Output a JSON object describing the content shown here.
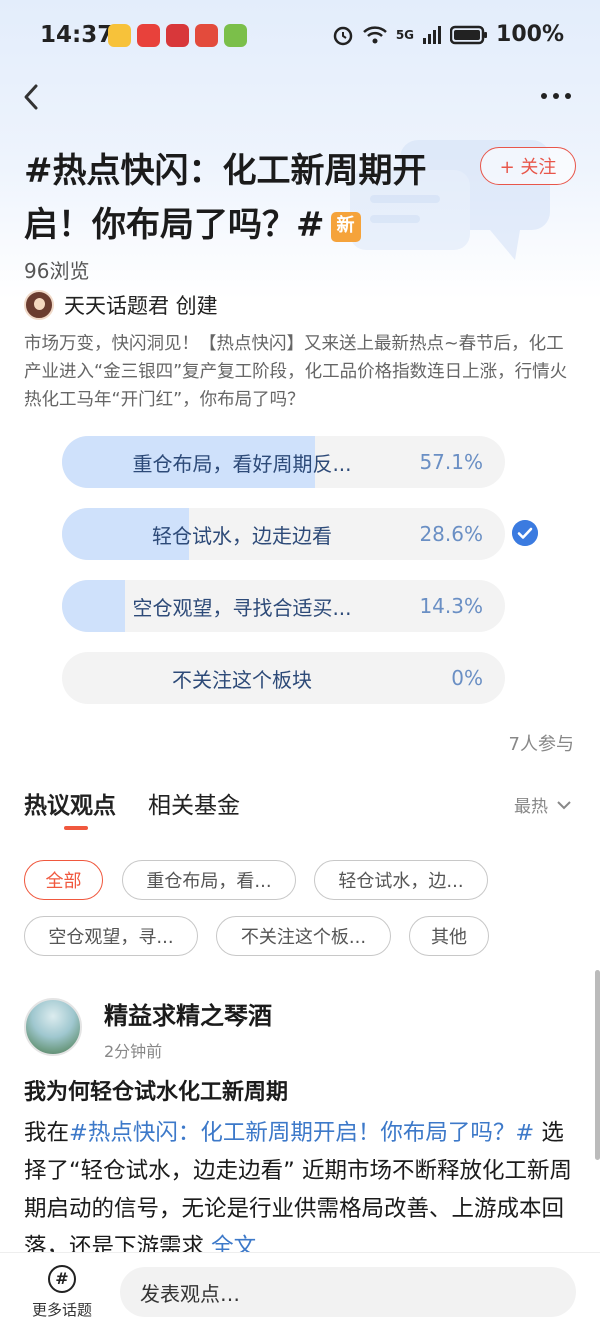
{
  "status_bar": {
    "time": "14:37",
    "network": "5G",
    "battery": "100%",
    "app_icon_colors": [
      "#f7c23a",
      "#e8413b",
      "#d8373a",
      "#e34b3c",
      "#7bbf4a"
    ]
  },
  "nav": {
    "back_icon": "chevron-left-icon",
    "more_icon": "more-horizontal-icon"
  },
  "topic": {
    "title": "#热点快闪：化工新周期开启！你布局了吗？#",
    "new_badge": "新",
    "follow_label": "+ 关注",
    "views": "96浏览",
    "creator": "天天话题君 创建",
    "description": "市场万变，快闪洞见！【热点快闪】又来送上最新热点~春节后，化工产业进入“金三银四”复产复工阶段，化工品价格指数连日上涨，行情火热化工马年“开门红”，你布局了吗？"
  },
  "poll": {
    "options": [
      {
        "label": "重仓布局，看好周期反...",
        "percent_text": "57.1%",
        "fraction": 0.571,
        "selected": false
      },
      {
        "label": "轻仓试水，边走边看",
        "percent_text": "28.6%",
        "fraction": 0.286,
        "selected": true
      },
      {
        "label": "空仓观望，寻找合适买...",
        "percent_text": "14.3%",
        "fraction": 0.143,
        "selected": false
      },
      {
        "label": "不关注这个板块",
        "percent_text": "0%",
        "fraction": 0,
        "selected": false
      }
    ],
    "participants": "7人参与"
  },
  "tabs": {
    "items": [
      "热议观点",
      "相关基金"
    ],
    "active": 0,
    "sort_label": "最热"
  },
  "filters": [
    "全部",
    "重仓布局，看...",
    "轻仓试水，边...",
    "空仓观望，寻...",
    "不关注这个板...",
    "其他"
  ],
  "post": {
    "user": "精益求精之琴酒",
    "time": "2分钟前",
    "title": "我为何轻仓试水化工新周期",
    "body_prefix": "我在",
    "hashtag": "#热点快闪：化工新周期开启！你布局了吗？#",
    "body_text": " 选择了“轻仓试水，边走边看” 近期市场不断释放化工新周期启动的信号，无论是行业供需格局改善、上游成本回落，还是下游需求",
    "full_text_label": "全文"
  },
  "bottom_bar": {
    "more_topics_icon": "hashtag-icon",
    "more_topics_label": "更多话题",
    "input_placeholder": "发表观点…"
  },
  "colors": {
    "accent": "#f0583e",
    "poll_fill": "#cfe1fb",
    "link": "#3d79c9",
    "check": "#3b7be0",
    "badge": "#f5a33b"
  }
}
